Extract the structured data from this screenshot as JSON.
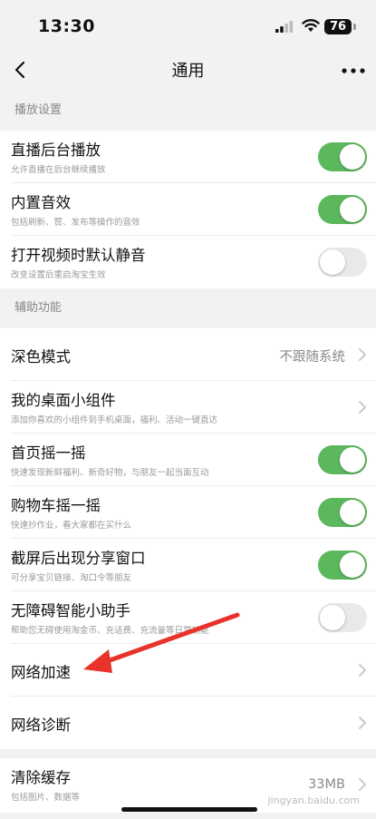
{
  "status_bar": {
    "time": "13:30",
    "battery": "76"
  },
  "nav": {
    "title": "通用"
  },
  "sections": [
    {
      "header": "播放设置",
      "rows": [
        {
          "title": "直播后台播放",
          "subtitle": "允许直播在后台继续播放",
          "toggle": true
        },
        {
          "title": "内置音效",
          "subtitle": "包括刷新、赞、发布等操作的音效",
          "toggle": true
        },
        {
          "title": "打开视频时默认静音",
          "subtitle": "改变设置后重启淘宝生效",
          "toggle": false
        }
      ]
    },
    {
      "header": "辅助功能",
      "rows": [
        {
          "title": "深色模式",
          "value": "不跟随系统"
        },
        {
          "title": "我的桌面小组件",
          "subtitle": "添加你喜欢的小组件到手机桌面，福利、活动一键直达"
        },
        {
          "title": "首页摇一摇",
          "subtitle": "快速发现新鲜福利、新奇好物，与朋友一起当面互动",
          "toggle": true
        },
        {
          "title": "购物车摇一摇",
          "subtitle": "快速抄作业，看大家都在买什么",
          "toggle": true
        },
        {
          "title": "截屏后出现分享窗口",
          "subtitle": "可分享宝贝链接、淘口令等朋友",
          "toggle": true
        },
        {
          "title": "无障碍智能小助手",
          "subtitle": "帮助您无碍使用淘金币、充话费、充流量等日常功能",
          "toggle": false
        },
        {
          "title": "网络加速"
        },
        {
          "title": "网络诊断"
        }
      ]
    },
    {
      "rows": [
        {
          "title": "清除缓存",
          "subtitle": "包括图片、数据等",
          "value": "33MB"
        }
      ]
    }
  ],
  "watermark": "jingyan.baidu.com",
  "colors": {
    "toggle_on": "#5cb85c",
    "toggle_off": "#e9e9ea",
    "annotation_arrow": "#e8322a"
  }
}
